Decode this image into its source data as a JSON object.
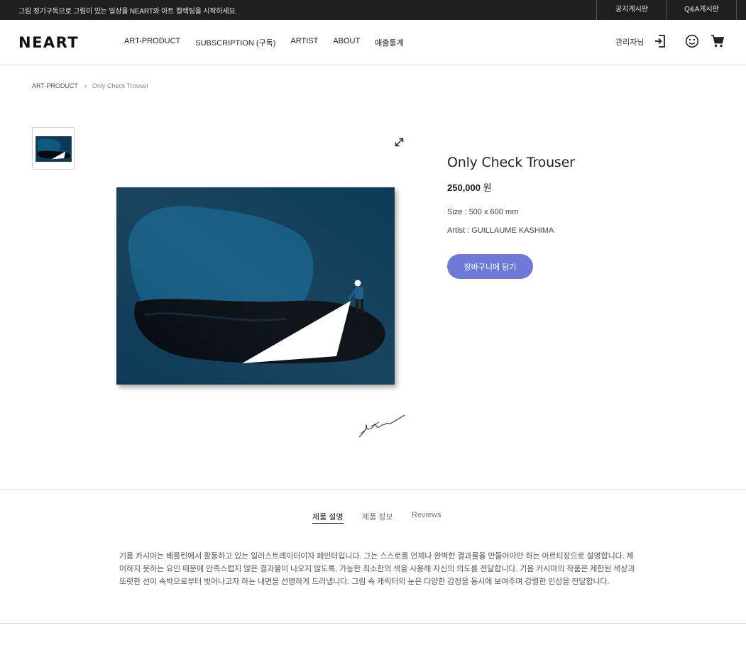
{
  "topbar": {
    "notice": "그림 정기구독으로 그림이 있는 일상을 NEART와 아트 컬렉팅을 시작하세요.",
    "links": [
      "공지게시판",
      "Q&A게시판"
    ]
  },
  "header": {
    "logo": "NEART",
    "nav": [
      "ART-PRODUCT",
      "SUBSCRIPTION (구독)",
      "ARTIST",
      "ABOUT",
      "매출통계"
    ],
    "admin_label": "관리자님",
    "icons": [
      "login-icon",
      "smile-icon",
      "cart-icon"
    ]
  },
  "breadcrumb": {
    "parent": "ART-PRODUCT",
    "separator": "›",
    "current": "Only Check Trouser"
  },
  "product": {
    "title": "Only Check Trouser",
    "price": "250,000",
    "price_unit": "원",
    "size": "Size : 500 x 600 mm",
    "artist": "Artist : GUILLAUME KASHIMA",
    "cart_button": "장바구니에 담기"
  },
  "tabs": {
    "items": [
      "제품 설명",
      "제품 정보",
      "Reviews"
    ],
    "active": "제품 설명"
  },
  "description": "기욤 카시마는 베를린에서 활동하고 있는 일러스트레이터이자 페인터입니다. 그는 스스로를 언제나 완벽한 결과물을 만들어야만 하는 아르티장으로 설명합니다. 제어하지 못하는 요인 때문에 만족스럽지 않은 결과물이 나오지 않도록, 가능한 최소한의 색을 사용해 자신의 의도를 전달합니다. 기욤 카시마의 작품은 제한된 색상과 또렷한 선이 속박으로부터 벗어나고자 하는 내면을 선명하게 드러냅니다. 그림 속 캐릭터의 눈은 다양한 감정을 동시에 보여주며 강렬한 인상을 전달합니다.",
  "colors": {
    "topbar_bg": "#1f1f1f",
    "accent_button": "#6f79d8",
    "art_background": "#0d3b57",
    "art_blob": "#11587f"
  }
}
